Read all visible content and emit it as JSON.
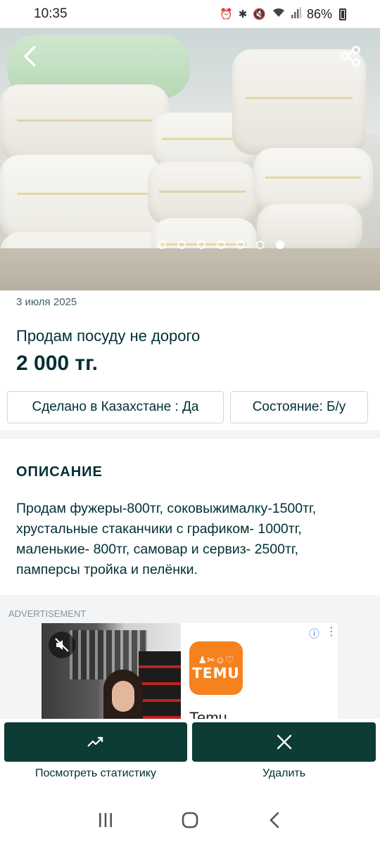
{
  "status_bar": {
    "time": "10:35",
    "battery": "86%",
    "icons": [
      "alarm-icon",
      "bluetooth-icon",
      "mute-icon",
      "wifi-icon",
      "signal-icon",
      "battery-icon"
    ]
  },
  "gallery": {
    "dots_total": 7,
    "active_dot": 7
  },
  "listing": {
    "date": "3 июля 2025",
    "title": "Продам посуду не дорого",
    "price": "2 000 тг.",
    "params": [
      "Сделано в Казахстане : Да",
      "Состояние: Б/у"
    ]
  },
  "description": {
    "heading": "ОПИСАНИЕ",
    "text": "Продам фужеры-800тг, соковыжималку-1500тг, хрустальные стаканчики с графиком- 1000тг, маленькие- 800тг, самовар и сервиз- 2500тг, памперсы тройка и пелёнки."
  },
  "ad": {
    "label": "ADVERTISEMENT",
    "brand_logo_text": "TEMU",
    "brand_name": "Temu"
  },
  "actions": {
    "stats_label": "Посмотреть статистику",
    "delete_label": "Удалить"
  },
  "colors": {
    "primary_dark": "#0d3b36",
    "text": "#002f34",
    "temu_orange": "#f6811f"
  }
}
